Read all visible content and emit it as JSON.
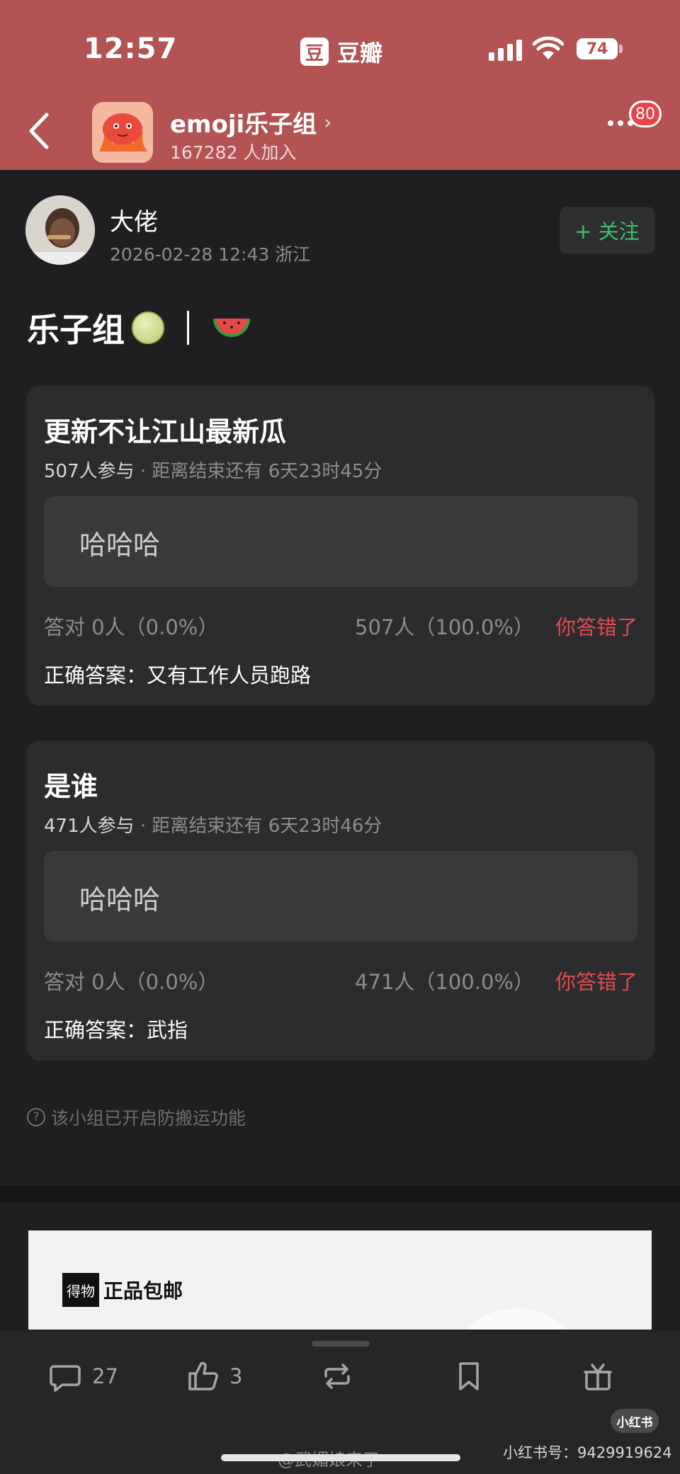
{
  "status_bar": {
    "time": "12:57",
    "app_icon_char": "豆",
    "app_name": "豆瓣",
    "battery": "74"
  },
  "group": {
    "name": "emoji乐子组",
    "members": "167282 人加入",
    "notifications": "80"
  },
  "post": {
    "author": "大佬",
    "meta": "2026-02-28 12:43  浙江",
    "follow_label": "+ 关注",
    "title": "乐子组"
  },
  "polls": [
    {
      "question": "更新不让江山最新瓜",
      "participants": "507人参与",
      "remaining": " · 距离结束还有 6天23时45分",
      "option": "哈哈哈",
      "correct_stat": "答对  0人（0.0%）",
      "option_stat": "507人（100.0%）",
      "result": "你答错了",
      "answer": "正确答案：又有工作人员跑路"
    },
    {
      "question": "是谁",
      "participants": "471人参与",
      "remaining": " · 距离结束还有 6天23时46分",
      "option": "哈哈哈",
      "correct_stat": "答对  0人（0.0%）",
      "option_stat": "471人（100.0%）",
      "result": "你答错了",
      "answer": "正确答案：武指"
    }
  ],
  "notice": "该小组已开启防搬运功能",
  "ad": {
    "logo": "得物",
    "text": "正品包邮"
  },
  "bottom_bar": {
    "comments": "27",
    "likes": "3"
  },
  "watermarks": {
    "xhs_badge": "小红书",
    "xhs_id": "小红书号：9429919624",
    "weibo": "@武媚娘来了"
  },
  "colors": {
    "header": "#b35353",
    "background": "#1f1f21",
    "card": "#2c2c2f",
    "follow_green": "#3ec06f",
    "wrong_red": "#e24b50"
  }
}
